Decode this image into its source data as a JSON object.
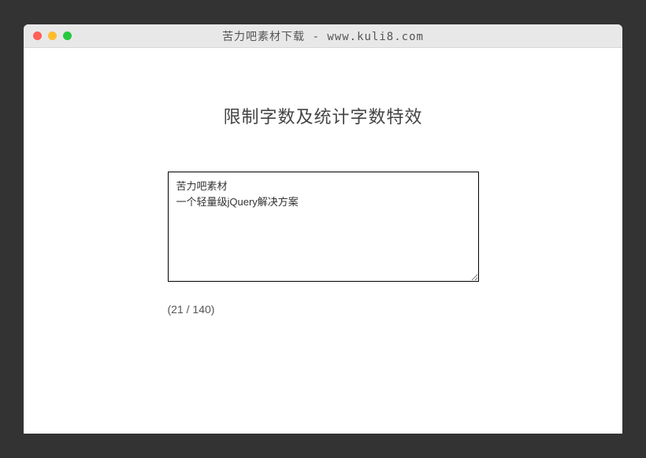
{
  "titlebar": {
    "title": "苦力吧素材下载 - www.kuli8.com"
  },
  "main": {
    "heading": "限制字数及统计字数特效",
    "textarea_value": "苦力吧素材\n一个轻量级jQuery解决方案",
    "counter_text": "(21 / 140)",
    "char_count": 21,
    "char_limit": 140
  }
}
